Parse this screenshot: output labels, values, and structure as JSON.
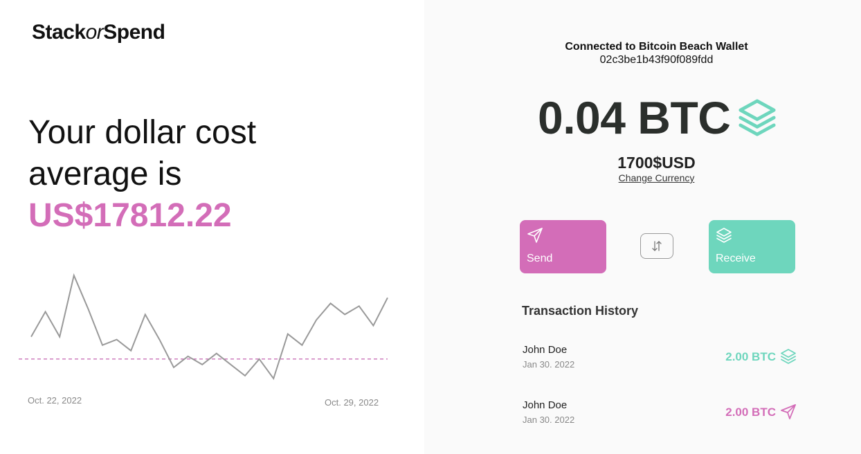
{
  "brand": {
    "stack": "Stack",
    "or": "or",
    "spend": "Spend"
  },
  "headline": {
    "line1": "Your dollar cost",
    "line2": "average is",
    "amount": "US$17812.22"
  },
  "chart_data": {
    "type": "line",
    "x_labels": [
      "Oct. 22, 2022",
      "Oct. 29, 2022"
    ],
    "values": [
      72,
      81,
      72,
      94,
      82,
      69,
      71,
      67,
      80,
      71,
      61,
      65,
      62,
      66,
      62,
      58,
      64,
      57,
      73,
      69,
      78,
      84,
      80,
      83,
      76,
      86
    ],
    "reference_value": 64,
    "line_color": "#999999",
    "reference_color": "#c463b0"
  },
  "wallet": {
    "connected_label": "Connected to Bitcoin Beach Wallet",
    "address": "02c3be1b43f90f089fdd",
    "balance": "0.04 BTC",
    "usd_value": "1700$USD",
    "change_currency": "Change Currency",
    "stack_icon": "layers-icon"
  },
  "actions": {
    "send_label": "Send",
    "receive_label": "Receive",
    "send_icon": "send-icon",
    "receive_icon": "layers-icon",
    "swap_icon": "swap-arrows-icon"
  },
  "colors": {
    "accent_pink": "#d36db8",
    "accent_teal": "#6ed6bd"
  },
  "transactions": {
    "title": "Transaction History",
    "items": [
      {
        "name": "John Doe",
        "date": "Jan 30. 2022",
        "amount": "2.00 BTC",
        "type": "receive",
        "icon": "layers-icon"
      },
      {
        "name": "John Doe",
        "date": "Jan 30. 2022",
        "amount": "2.00 BTC",
        "type": "send",
        "icon": "send-icon"
      }
    ]
  }
}
